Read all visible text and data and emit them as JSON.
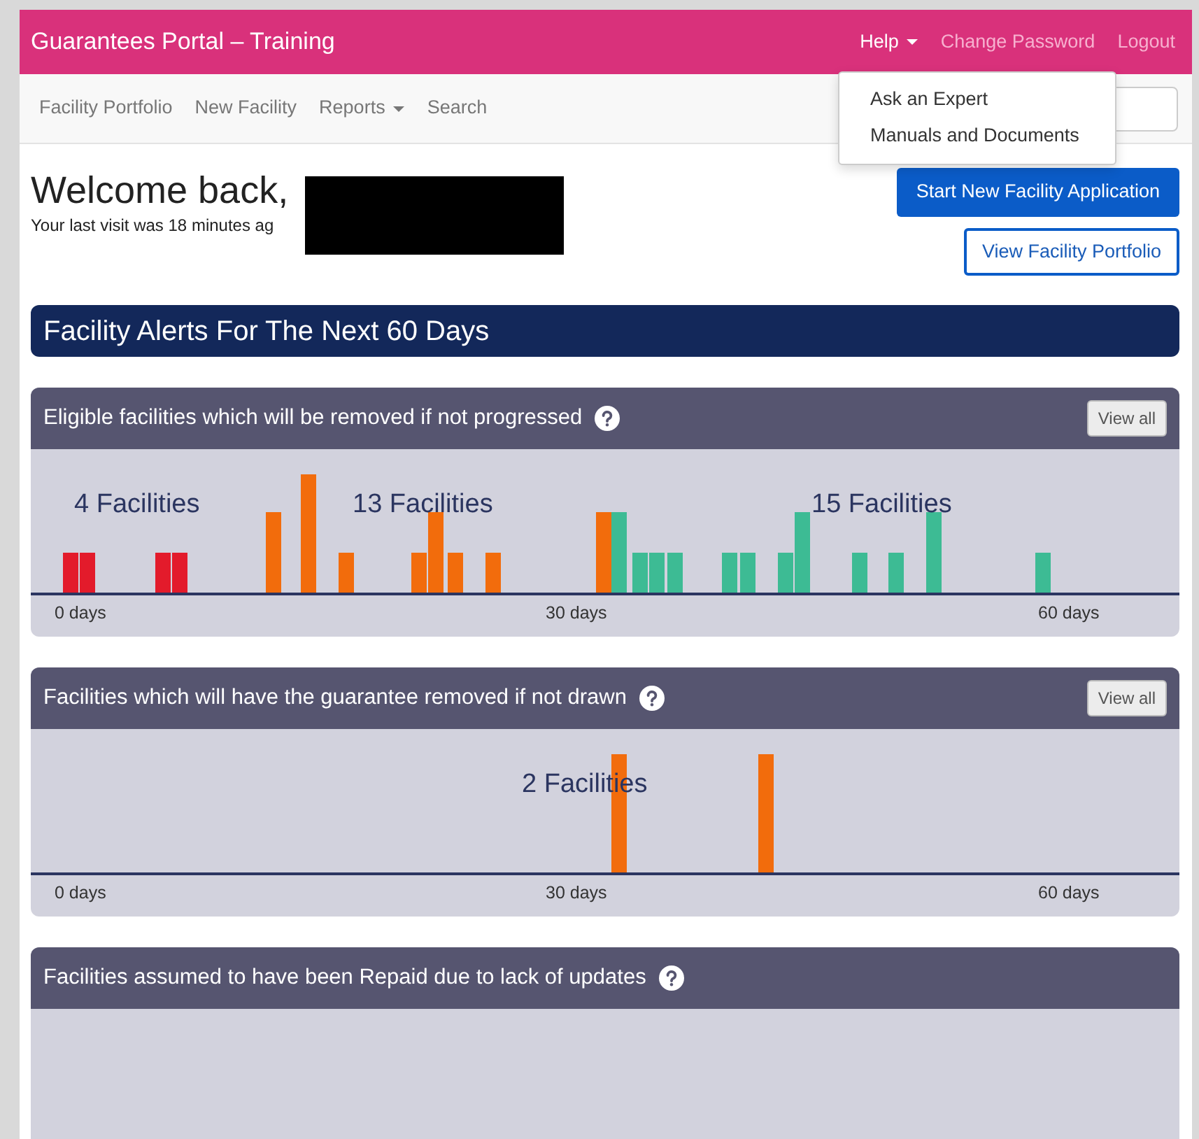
{
  "navbar": {
    "brand": "Guarantees Portal – Training",
    "links": [
      {
        "label": "Help",
        "kind": "dropdown",
        "expanded": true
      },
      {
        "label": "Change Password",
        "kind": "link",
        "expanded": false
      },
      {
        "label": "Logout",
        "kind": "link",
        "expanded": false
      }
    ]
  },
  "help_menu": {
    "items": [
      "Ask an Expert",
      "Manuals and Documents"
    ]
  },
  "subnav": {
    "items": [
      {
        "label": "Facility Portfolio",
        "kind": "link"
      },
      {
        "label": "New Facility",
        "kind": "link"
      },
      {
        "label": "Reports",
        "kind": "dropdown"
      },
      {
        "label": "Search",
        "kind": "link"
      }
    ]
  },
  "welcome": {
    "heading": "Welcome back,",
    "last_visit": "Your last visit was 18 minutes ag"
  },
  "actions": [
    {
      "label": "Start New Facility Application",
      "kind": "primary"
    },
    {
      "label": "View Facility Portfolio",
      "kind": "outline"
    }
  ],
  "alerts_title": "Facility Alerts For The Next 60 Days",
  "panels": [
    {
      "title": "Eligible facilities which will be removed if not progressed",
      "view_all": "View all",
      "axis_labels": [
        "0 days",
        "30 days",
        "60 days"
      ],
      "groups": [
        {
          "label": "4 Facilities",
          "color": "#e31b2b"
        },
        {
          "label": "13 Facilities",
          "color": "#f26c0c"
        },
        {
          "label": "15 Facilities",
          "color": "#3dbb94"
        }
      ]
    },
    {
      "title": "Facilities which will have the guarantee removed if not drawn",
      "view_all": "View all",
      "axis_labels": [
        "0 days",
        "30 days",
        "60 days"
      ],
      "groups": [
        {
          "label": "2 Facilities",
          "color": "#f26c0c"
        }
      ]
    },
    {
      "title": "Facilities assumed to have been Repaid due to lack of updates"
    }
  ]
}
